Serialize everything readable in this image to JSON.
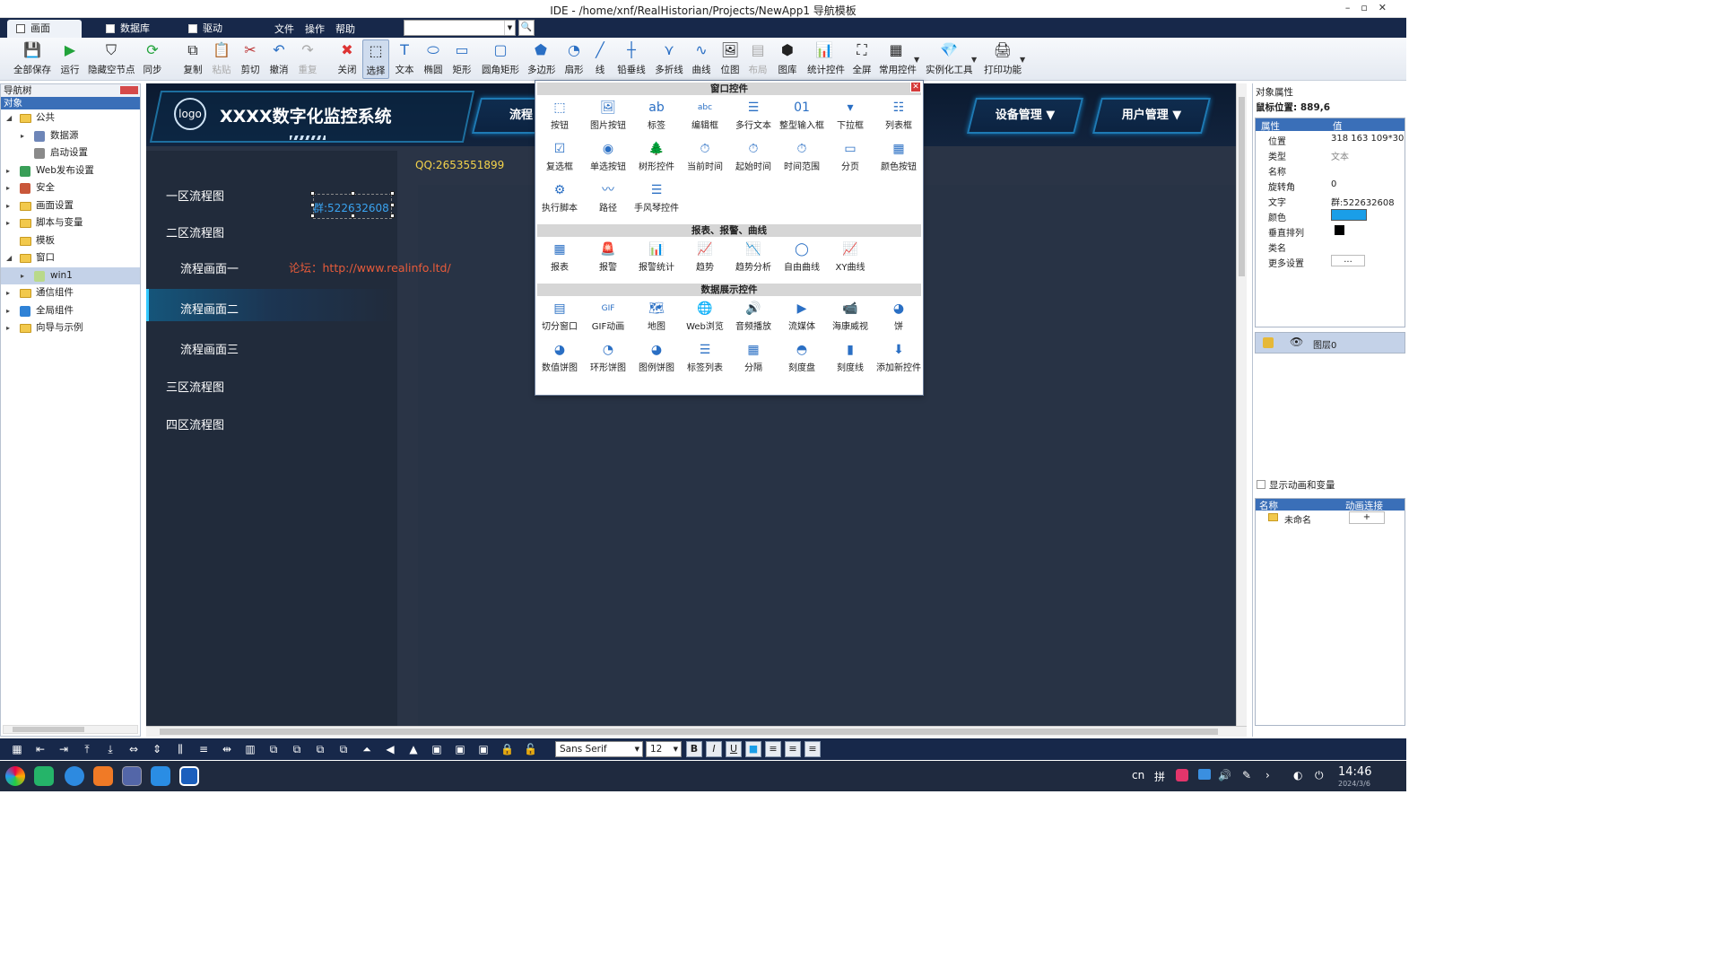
{
  "window": {
    "title": "IDE - /home/xnf/RealHistorian/Projects/NewApp1 导航模板"
  },
  "tabs": [
    {
      "label": "画面"
    },
    {
      "label": "数据库"
    },
    {
      "label": "驱动"
    }
  ],
  "menus": [
    "文件",
    "操作",
    "帮助"
  ],
  "toolbar": [
    {
      "label": "全部保存",
      "icon": "save-all-icon"
    },
    {
      "label": "运行",
      "icon": "run-icon"
    },
    {
      "label": "隐藏空节点",
      "icon": "hide-empty-icon"
    },
    {
      "label": "同步",
      "icon": "sync-icon"
    },
    {
      "label": "复制",
      "icon": "copy-icon"
    },
    {
      "label": "粘贴",
      "icon": "paste-icon"
    },
    {
      "label": "剪切",
      "icon": "cut-icon"
    },
    {
      "label": "撤消",
      "icon": "undo-icon"
    },
    {
      "label": "重复",
      "icon": "redo-icon"
    },
    {
      "label": "关闭",
      "icon": "close-doc-icon"
    },
    {
      "label": "选择",
      "icon": "select-icon"
    },
    {
      "label": "文本",
      "icon": "text-icon"
    },
    {
      "label": "椭圆",
      "icon": "ellipse-icon"
    },
    {
      "label": "矩形",
      "icon": "rectangle-icon"
    },
    {
      "label": "圆角矩形",
      "icon": "rounded-rect-icon"
    },
    {
      "label": "多边形",
      "icon": "polygon-icon"
    },
    {
      "label": "扇形",
      "icon": "sector-icon"
    },
    {
      "label": "线",
      "icon": "line-icon"
    },
    {
      "label": "铅垂线",
      "icon": "plumb-line-icon"
    },
    {
      "label": "多折线",
      "icon": "polyline-icon"
    },
    {
      "label": "曲线",
      "icon": "curve-icon"
    },
    {
      "label": "位图",
      "icon": "bitmap-icon"
    },
    {
      "label": "布局",
      "icon": "layout-icon"
    },
    {
      "label": "图库",
      "icon": "gallery-icon"
    },
    {
      "label": "统计控件",
      "icon": "stats-icon"
    },
    {
      "label": "全屏",
      "icon": "fullscreen-icon"
    },
    {
      "label": "常用控件",
      "icon": "common-controls-icon"
    },
    {
      "label": "实例化工具",
      "icon": "instantiate-icon"
    },
    {
      "label": "打印功能",
      "icon": "print-icon"
    }
  ],
  "nav": {
    "title": "导航树",
    "header": "对象",
    "items": [
      {
        "label": "公共"
      },
      {
        "label": "数据源"
      },
      {
        "label": "启动设置"
      },
      {
        "label": "Web发布设置"
      },
      {
        "label": "安全"
      },
      {
        "label": "画面设置"
      },
      {
        "label": "脚本与变量"
      },
      {
        "label": "模板"
      },
      {
        "label": "窗口"
      },
      {
        "label": "win1"
      },
      {
        "label": "通信组件"
      },
      {
        "label": "全局组件"
      },
      {
        "label": "向导与示例"
      }
    ]
  },
  "canvas": {
    "logo": "logo",
    "system_title": "XXXX数字化监控系统",
    "nav_buttons": [
      "流程",
      "设备管理 ▼",
      "用户管理 ▼"
    ],
    "menu": [
      "一区流程图",
      "二区流程图",
      "流程画面一",
      "流程画面二",
      "流程画面三",
      "三区流程图",
      "四区流程图"
    ],
    "qq": "QQ:2653551899",
    "group": "群:522632608",
    "forum": "论坛：http://www.realinfo.ltd/"
  },
  "palette": {
    "title": "窗口控件",
    "sections": [
      "报表、报警、曲线",
      "数据展示控件"
    ],
    "window_controls": [
      "按钮",
      "图片按钮",
      "标签",
      "编辑框",
      "多行文本",
      "整型输入框",
      "下拉框",
      "列表框",
      "复选框",
      "单选按钮",
      "树形控件",
      "当前时间",
      "起始时间",
      "时间范围",
      "分页",
      "颜色按钮",
      "执行脚本",
      "路径",
      "手风琴控件"
    ],
    "report_controls": [
      "报表",
      "报警",
      "报警统计",
      "趋势",
      "趋势分析",
      "自由曲线",
      "XY曲线"
    ],
    "data_controls": [
      "切分窗口",
      "GIF动画",
      "地图",
      "Web浏览",
      "音频播放",
      "流媒体",
      "海康威视",
      "饼",
      "数值饼图",
      "环形饼图",
      "图例饼图",
      "标签列表",
      "分隔",
      "刻度盘",
      "刻度线",
      "添加新控件"
    ]
  },
  "props": {
    "title": "对象属性",
    "mouse": "鼠标位置: 889,6",
    "col_attr": "属性",
    "col_val": "值",
    "rows": [
      {
        "k": "位置",
        "v": "318 163 109*30"
      },
      {
        "k": "类型",
        "v": "文本"
      },
      {
        "k": "名称",
        "v": ""
      },
      {
        "k": "旋转角",
        "v": "0"
      },
      {
        "k": "文字",
        "v": "群:522632608"
      },
      {
        "k": "颜色",
        "v": ""
      },
      {
        "k": "垂直排列",
        "v": ""
      },
      {
        "k": "类名",
        "v": ""
      },
      {
        "k": "更多设置",
        "v": "..."
      }
    ],
    "color": "#1a9ee8",
    "layer": "图层0",
    "show_anim": "显示动画和变量",
    "anim_col_name": "名称",
    "anim_col_link": "动画连接",
    "anim_row": "未命名",
    "anim_add": "+"
  },
  "format": {
    "font": "Sans Serif",
    "size": "12"
  },
  "clock": {
    "time": "14:46",
    "date": "2024/3/6"
  },
  "tray_lang": "cn",
  "tray_ime": "拼"
}
